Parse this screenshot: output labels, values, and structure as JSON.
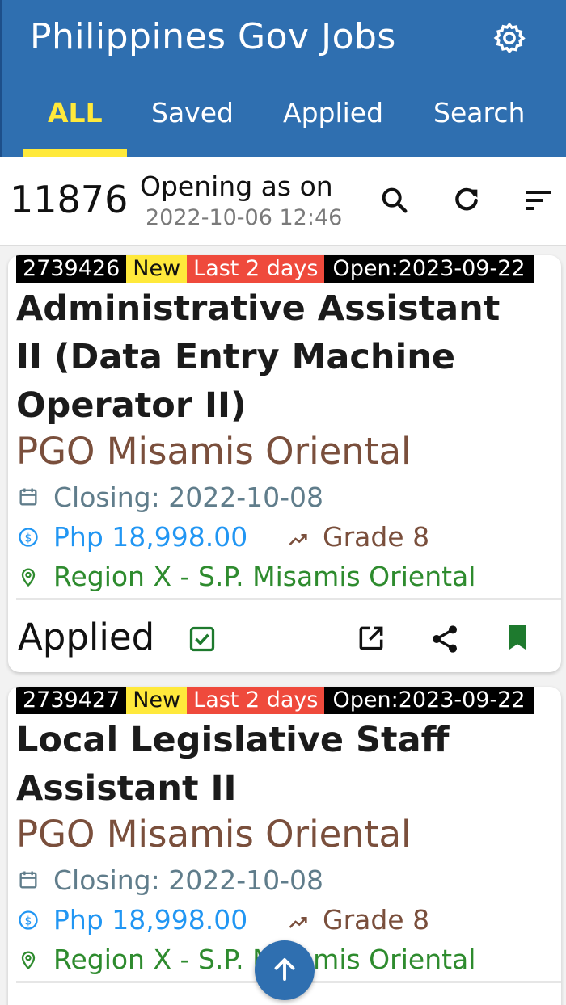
{
  "app": {
    "title": "Philippines Gov Jobs"
  },
  "tabs": [
    {
      "label": "ALL"
    },
    {
      "label": "Saved"
    },
    {
      "label": "Applied"
    },
    {
      "label": "Search"
    }
  ],
  "summary": {
    "count": "11876",
    "opening_label": "Opening as on",
    "opening_date": "2022-10-06 12:46"
  },
  "jobs": [
    {
      "id": "2739426",
      "badge_new": "New",
      "badge_deadline": "Last 2 days",
      "badge_open": "Open:2023-09-22",
      "title_lines": [
        "Administrative Assistant",
        "II (Data Entry Machine",
        "Operator II)"
      ],
      "employer": "PGO Misamis Oriental",
      "closing": "Closing: 2022-10-08",
      "salary": "Php 18,998.00",
      "grade": "Grade 8",
      "region": "Region X - S.P. Misamis Oriental",
      "status": "Applied"
    },
    {
      "id": "2739427",
      "badge_new": "New",
      "badge_deadline": "Last 2 days",
      "badge_open": "Open:2023-09-22",
      "title_lines": [
        "Local Legislative Staff",
        "Assistant II"
      ],
      "employer": "PGO Misamis Oriental",
      "closing": "Closing: 2022-10-08",
      "salary": "Php 18,998.00",
      "grade": "Grade 8",
      "region": "Region X - S.P. Misamis Oriental"
    }
  ],
  "colors": {
    "primary": "#2f6fb0",
    "tab_active": "#ffe93b",
    "employer": "#7a4f3c",
    "salary": "#2196f3",
    "region": "#2e8b2e",
    "closing": "#607d8b",
    "bookmark": "#1e7a2e"
  },
  "icons": [
    "gear-icon",
    "search-icon",
    "refresh-icon",
    "sort-icon",
    "calendar-icon",
    "currency-icon",
    "trending-icon",
    "location-icon",
    "checkbox-icon",
    "open-external-icon",
    "share-icon",
    "bookmark-icon",
    "arrow-up-icon"
  ]
}
